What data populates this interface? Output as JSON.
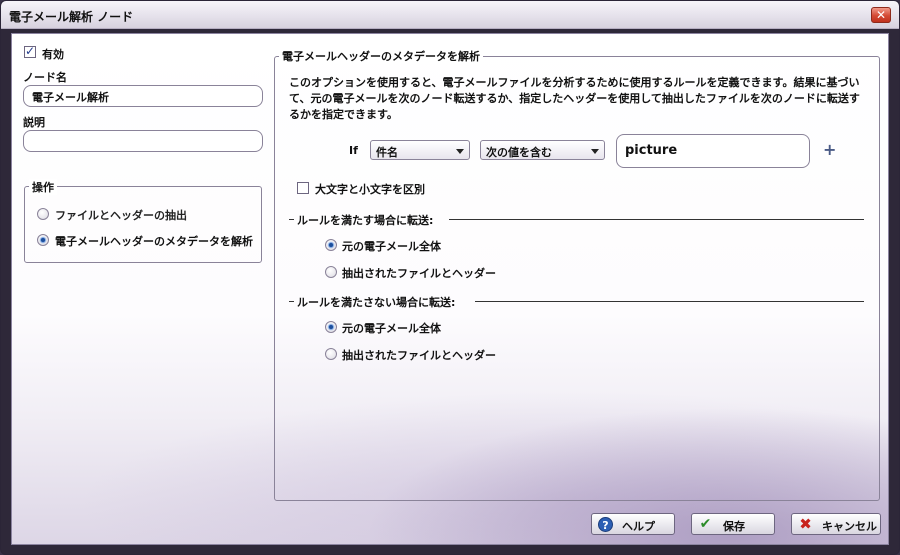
{
  "window": {
    "title": "電子メール解析 ノード",
    "close_glyph": "✕"
  },
  "left": {
    "enabled_label": "有効",
    "enabled_checked": true,
    "node_name_label": "ノード名",
    "node_name_value": "電子メール解析",
    "description_label": "説明",
    "description_value": "",
    "operation": {
      "legend": "操作",
      "options": [
        {
          "label": "ファイルとヘッダーの抽出",
          "selected": false
        },
        {
          "label": "電子メールヘッダーのメタデータを解析",
          "selected": true
        }
      ]
    }
  },
  "right": {
    "legend": "電子メールヘッダーのメタデータを解析",
    "description": "このオプションを使用すると、電子メールファイルを分析するために使用するルールを定義できます。結果に基づいて、元の電子メールを次のノード転送するか、指定したヘッダーを使用して抽出したファイルを次のノードに転送するかを指定できます。",
    "rule": {
      "if_label": "If",
      "field_select": "件名",
      "operator_select": "次の値を含む",
      "value": "picture",
      "add_glyph": "+"
    },
    "case_sensitive_label": "大文字と小文字を区別",
    "case_sensitive_checked": false,
    "match_section": {
      "title": "ルールを満たす場合に転送:",
      "options": [
        {
          "label": "元の電子メール全体",
          "selected": true
        },
        {
          "label": "抽出されたファイルとヘッダー",
          "selected": false
        }
      ]
    },
    "nomatch_section": {
      "title": "ルールを満たさない場合に転送:",
      "options": [
        {
          "label": "元の電子メール全体",
          "selected": true
        },
        {
          "label": "抽出されたファイルとヘッダー",
          "selected": false
        }
      ]
    }
  },
  "buttons": {
    "help": "ヘルプ",
    "save": "保存",
    "cancel": "キャンセル",
    "help_glyph": "?",
    "save_glyph": "✔",
    "cancel_glyph": "✖"
  },
  "colors": {
    "accent": "#2d5fb4",
    "cancel_icon": "#c8231d",
    "save_icon": "#2c8c2a"
  }
}
